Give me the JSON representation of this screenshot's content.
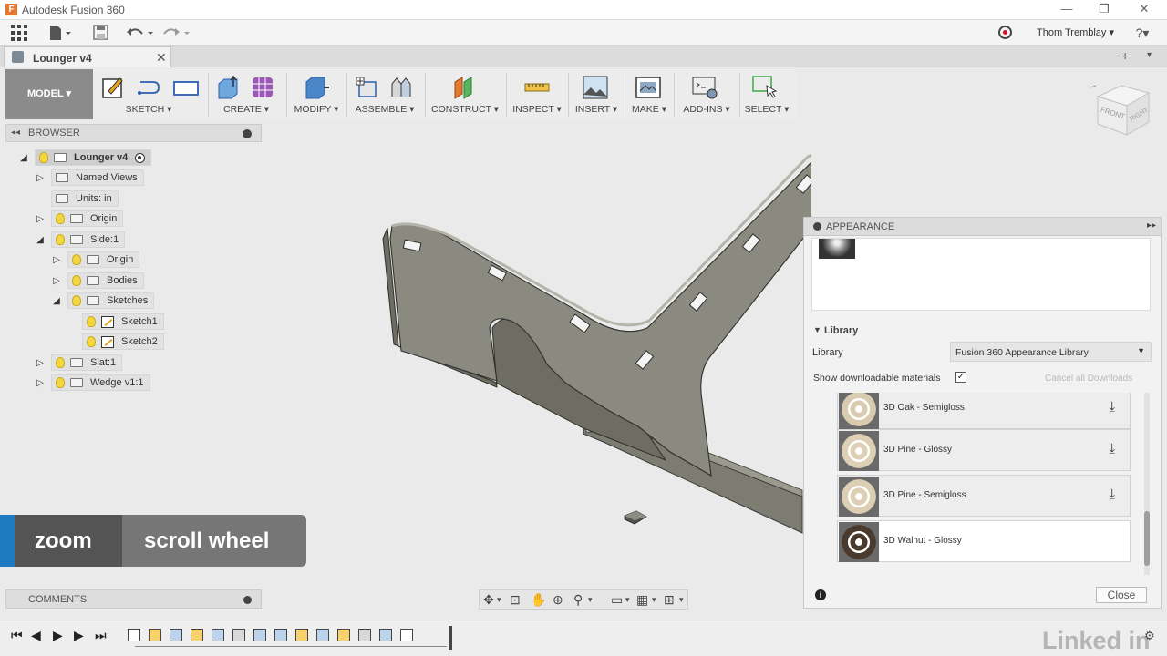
{
  "window": {
    "title": "Autodesk Fusion 360",
    "logo_letter": "F"
  },
  "window_controls": {
    "minimize": "—",
    "maximize": "❐",
    "close": "✕"
  },
  "qab": {
    "user_name": "Thom Tremblay ▾",
    "help": "?▾"
  },
  "doc_tab": {
    "title": "Lounger v4",
    "close": "✕"
  },
  "toolbar": {
    "workspace": "MODEL ▾",
    "groups": [
      {
        "id": "sketch",
        "label": "SKETCH ▾"
      },
      {
        "id": "create",
        "label": "CREATE ▾"
      },
      {
        "id": "modify",
        "label": "MODIFY ▾"
      },
      {
        "id": "assemble",
        "label": "ASSEMBLE ▾"
      },
      {
        "id": "construct",
        "label": "CONSTRUCT ▾"
      },
      {
        "id": "inspect",
        "label": "INSPECT ▾"
      },
      {
        "id": "insert",
        "label": "INSERT ▾"
      },
      {
        "id": "make",
        "label": "MAKE ▾"
      },
      {
        "id": "addins",
        "label": "ADD-INS ▾"
      },
      {
        "id": "select",
        "label": "SELECT ▾"
      }
    ]
  },
  "browser": {
    "header": "BROWSER",
    "items": [
      {
        "label": "Lounger v4",
        "exp": "◢",
        "bulb": true,
        "folder": false
      },
      {
        "label": "Named Views",
        "exp": "▷",
        "bulb": false,
        "folder": true
      },
      {
        "label": "Units: in",
        "exp": "",
        "bulb": false,
        "folder": true
      },
      {
        "label": "Origin",
        "exp": "▷",
        "bulb": true,
        "folder": true
      },
      {
        "label": "Side:1",
        "exp": "◢",
        "bulb": true,
        "folder": true
      },
      {
        "label": "Origin",
        "exp": "▷",
        "bulb": true,
        "folder": true
      },
      {
        "label": "Bodies",
        "exp": "▷",
        "bulb": true,
        "folder": true
      },
      {
        "label": "Sketches",
        "exp": "◢",
        "bulb": true,
        "folder": true
      },
      {
        "label": "Sketch1",
        "exp": "",
        "bulb": true,
        "folder": false
      },
      {
        "label": "Sketch2",
        "exp": "",
        "bulb": true,
        "folder": false
      },
      {
        "label": "Slat:1",
        "exp": "▷",
        "bulb": true,
        "folder": true
      },
      {
        "label": "Wedge v1:1",
        "exp": "▷",
        "bulb": true,
        "folder": true
      }
    ]
  },
  "comments": {
    "header": "COMMENTS"
  },
  "overlay": {
    "action": "zoom",
    "input": "scroll wheel"
  },
  "viewcube": {
    "front": "FRONT",
    "right": "RIGHT"
  },
  "appearance": {
    "header": "APPEARANCE",
    "library_section": "Library",
    "library_label": "Library",
    "library_value": "Fusion 360 Appearance Library",
    "show_downloadable_label": "Show downloadable materials",
    "show_downloadable_checked": true,
    "check_glyph": "✓",
    "cancel_downloads": "Cancel all Downloads",
    "materials": [
      {
        "name": "3D Oak - Semigloss",
        "swatch": "#d9cbb0",
        "download": "⤓"
      },
      {
        "name": "3D Pine - Glossy",
        "swatch": "#ddd0b4",
        "download": "⤓"
      },
      {
        "name": "3D Pine - Semigloss",
        "swatch": "#dccfb3",
        "download": "⤓"
      },
      {
        "name": "3D Walnut - Glossy",
        "swatch": "#4a3a2e",
        "download": ""
      }
    ],
    "info_glyph": "i",
    "close_label": "Close"
  },
  "brand": {
    "linkedin": "Linked in"
  }
}
